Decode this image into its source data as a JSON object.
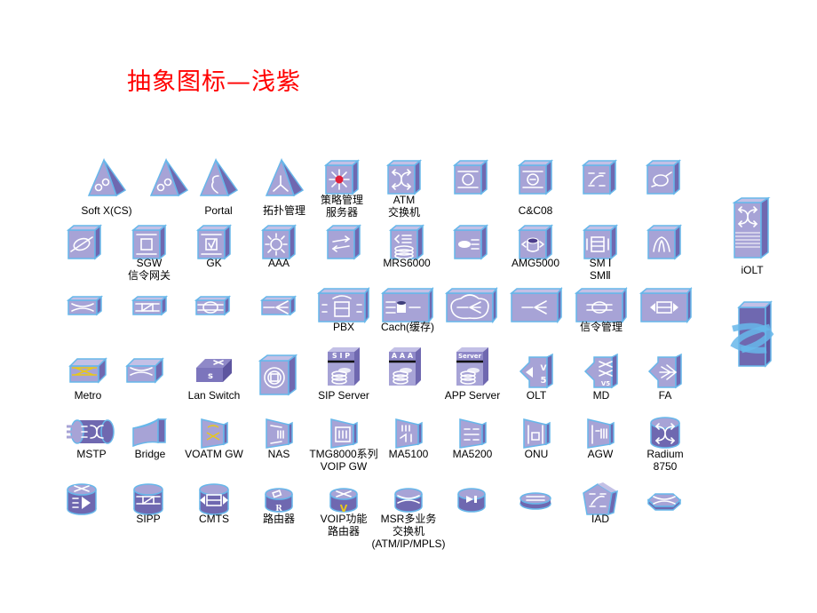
{
  "title": "抽象图标—浅紫",
  "colors": {
    "title": "#ff0000",
    "face": "#a7a3d6",
    "side": "#6f68b0",
    "top": "#c3c0e6",
    "edge": "#67b7ea",
    "glyph": "#ffffff",
    "accent_red": "#e0203a",
    "accent_yellow": "#e8c818"
  },
  "icons": [
    {
      "id": "soft-x-cs",
      "shape": "pyramid",
      "glyph": "gears",
      "label": "Soft X(CS)"
    },
    {
      "id": "pyramid-gears-2",
      "shape": "pyramid",
      "glyph": "gears",
      "label": ""
    },
    {
      "id": "portal",
      "shape": "pyramid",
      "glyph": "epsilon",
      "label": "Portal"
    },
    {
      "id": "topology-management",
      "shape": "pyramid",
      "glyph": "tri-branch",
      "label": "拓扑管理"
    },
    {
      "id": "policy-server",
      "shape": "cube",
      "glyph": "star-red",
      "label": "策略管理\n服务器"
    },
    {
      "id": "atm-switch",
      "shape": "cube",
      "glyph": "cross-arrows",
      "label": "ATM\n交换机"
    },
    {
      "id": "cube-circle-arrows",
      "shape": "cube",
      "glyph": "circle-arrows",
      "label": ""
    },
    {
      "id": "cc08",
      "shape": "cube",
      "glyph": "circle-bar-arrows",
      "label": "C&C08"
    },
    {
      "id": "cube-curve-arrows",
      "shape": "cube",
      "glyph": "curve-arrows",
      "label": ""
    },
    {
      "id": "cube-loop-arrow",
      "shape": "cube",
      "glyph": "loop-arrow",
      "label": ""
    },
    {
      "id": "cube-oval-arrow",
      "shape": "cube",
      "glyph": "oval-arrow",
      "label": ""
    },
    {
      "id": "sgw",
      "shape": "cube",
      "glyph": "square-arrows",
      "label": "SGW\n信令网关"
    },
    {
      "id": "gk",
      "shape": "cube",
      "glyph": "square-check",
      "label": "GK"
    },
    {
      "id": "aaa",
      "shape": "cube",
      "glyph": "burst",
      "label": "AAA"
    },
    {
      "id": "cube-double-arrows",
      "shape": "cube",
      "glyph": "double-arrows",
      "label": ""
    },
    {
      "id": "mrs6000",
      "shape": "cube",
      "glyph": "disk-stack",
      "label": "MRS6000"
    },
    {
      "id": "cube-oval-lines",
      "shape": "cube",
      "glyph": "oval-lines",
      "label": ""
    },
    {
      "id": "amg5000",
      "shape": "cube",
      "glyph": "db-arrows",
      "label": "AMG5000"
    },
    {
      "id": "sm",
      "shape": "cube",
      "glyph": "box-arrows",
      "label": "SM Ⅰ\nSMⅡ"
    },
    {
      "id": "cube-up-arrows",
      "shape": "cube",
      "glyph": "up-arrows",
      "label": ""
    },
    {
      "id": "iolt",
      "shape": "tower",
      "glyph": "cross-lines",
      "label": "iOLT"
    },
    {
      "id": "tower-wrap",
      "shape": "tower-wrap",
      "glyph": "wrap-arrows",
      "label": ""
    },
    {
      "id": "flat-x",
      "shape": "flat",
      "glyph": "x-lines",
      "label": ""
    },
    {
      "id": "flat-x-box",
      "shape": "flat",
      "glyph": "x-box",
      "label": ""
    },
    {
      "id": "flat-circle-bars",
      "shape": "flat",
      "glyph": "circle-bars",
      "label": ""
    },
    {
      "id": "flat-fan",
      "shape": "flat",
      "glyph": "fan",
      "label": ""
    },
    {
      "id": "pbx",
      "shape": "flat-big",
      "glyph": "phone",
      "label": "PBX"
    },
    {
      "id": "cache",
      "shape": "flat-big",
      "glyph": "cache",
      "label": "Cach(缓存)"
    },
    {
      "id": "flat-cloud-fan",
      "shape": "flat-big",
      "glyph": "cloud-fan",
      "label": ""
    },
    {
      "id": "flat-fan-big",
      "shape": "flat-big",
      "glyph": "fan",
      "label": ""
    },
    {
      "id": "signaling-management",
      "shape": "flat-big",
      "glyph": "circle-bars",
      "label": "信令管理"
    },
    {
      "id": "flat-box-arrows",
      "shape": "flat-big",
      "glyph": "box-lr",
      "label": ""
    },
    {
      "id": "metro",
      "shape": "slab",
      "glyph": "metro",
      "label": "Metro"
    },
    {
      "id": "slab-switch",
      "shape": "slab",
      "glyph": "x-lines",
      "label": ""
    },
    {
      "id": "lan-switch",
      "shape": "slab-dark",
      "glyph": "s-switch",
      "label": "Lan Switch"
    },
    {
      "id": "cube-disc",
      "shape": "cube-big",
      "glyph": "disc",
      "label": ""
    },
    {
      "id": "sip-server",
      "shape": "server",
      "glyph": "SIP",
      "label": "SIP Server"
    },
    {
      "id": "aaa-server",
      "shape": "server",
      "glyph": "AAA",
      "label": ""
    },
    {
      "id": "app-server",
      "shape": "server",
      "glyph": "Server",
      "label": "APP Server"
    },
    {
      "id": "olt",
      "shape": "v5",
      "glyph": "v5-arrow",
      "label": "OLT"
    },
    {
      "id": "md",
      "shape": "v5",
      "glyph": "v5-x",
      "label": "MD"
    },
    {
      "id": "fa",
      "shape": "v5",
      "glyph": "fa-arrows",
      "label": "FA"
    },
    {
      "id": "mstp",
      "shape": "cylinder-side",
      "glyph": "mstp",
      "label": "MSTP"
    },
    {
      "id": "bridge",
      "shape": "bridge",
      "glyph": "",
      "label": "Bridge"
    },
    {
      "id": "voatm-gw",
      "shape": "panel",
      "glyph": "voatm",
      "label": "VOATM GW"
    },
    {
      "id": "nas",
      "shape": "panel",
      "glyph": "bars",
      "label": "NAS"
    },
    {
      "id": "tmg8000",
      "shape": "panel",
      "glyph": "bars-box",
      "label": "TMG8000系列\nVOIP GW"
    },
    {
      "id": "ma5100",
      "shape": "panel",
      "glyph": "ma5100",
      "label": "MA5100"
    },
    {
      "id": "ma5200",
      "shape": "panel",
      "glyph": "ma5200",
      "label": "MA5200"
    },
    {
      "id": "onu",
      "shape": "panel",
      "glyph": "onu",
      "label": "ONU"
    },
    {
      "id": "agw",
      "shape": "panel",
      "glyph": "agw",
      "label": "AGW"
    },
    {
      "id": "radium-8750",
      "shape": "cylinder-tall",
      "glyph": "cross-arrows",
      "label": "Radium\n8750"
    },
    {
      "id": "cyl-play",
      "shape": "cylinder-tall",
      "glyph": "play",
      "label": ""
    },
    {
      "id": "sipp",
      "shape": "cylinder-tall",
      "glyph": "x-box",
      "label": "SIPP"
    },
    {
      "id": "cmts",
      "shape": "cylinder-tall",
      "glyph": "box-lr",
      "label": "CMTS"
    },
    {
      "id": "router",
      "shape": "cylinder",
      "glyph": "R",
      "label": "路由器"
    },
    {
      "id": "voip-router",
      "shape": "cylinder",
      "glyph": "V",
      "label": "VOIP功能\n路由器"
    },
    {
      "id": "msr",
      "shape": "cylinder",
      "glyph": "x-lines",
      "label": "MSR多业务\n交换机\n(ATM/IP/MPLS)"
    },
    {
      "id": "cyl-pause",
      "shape": "cylinder",
      "glyph": "play-bar",
      "label": ""
    },
    {
      "id": "cyl-flat",
      "shape": "cylinder-flat",
      "glyph": "arrows-flat",
      "label": ""
    },
    {
      "id": "iad",
      "shape": "pentagon",
      "glyph": "curve-arrows",
      "label": "IAD"
    },
    {
      "id": "hexagon",
      "shape": "hexagon",
      "glyph": "x-lines",
      "label": ""
    }
  ]
}
